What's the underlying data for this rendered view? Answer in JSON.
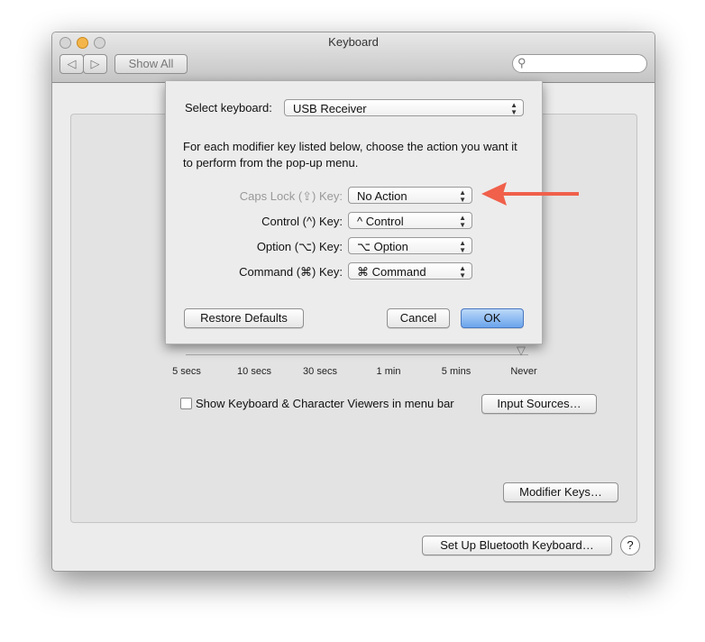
{
  "window": {
    "title": "Keyboard",
    "show_all": "Show All",
    "search_placeholder": ""
  },
  "background": {
    "delay_ticks": [
      "5 secs",
      "10 secs",
      "30 secs",
      "1 min",
      "5 mins",
      "Never"
    ],
    "show_viewers_label": "Show Keyboard & Character Viewers in menu bar",
    "show_viewers_checked": false,
    "input_sources": "Input Sources…",
    "modifier_keys": "Modifier Keys…",
    "bluetooth": "Set Up Bluetooth Keyboard…",
    "help": "?"
  },
  "sheet": {
    "select_keyboard_label": "Select keyboard:",
    "select_keyboard_value": "USB Receiver",
    "instructions": "For each modifier key listed below, choose the action you want it to perform from the pop-up menu.",
    "rows": [
      {
        "label": "Caps Lock (⇪) Key:",
        "value": "No Action",
        "dimmed": true
      },
      {
        "label": "Control (^) Key:",
        "value": "^ Control"
      },
      {
        "label": "Option (⌥) Key:",
        "value": "⌥ Option"
      },
      {
        "label": "Command (⌘) Key:",
        "value": "⌘ Command"
      }
    ],
    "restore_defaults": "Restore Defaults",
    "cancel": "Cancel",
    "ok": "OK"
  },
  "annotation": {
    "arrow_color": "#f0604a"
  }
}
